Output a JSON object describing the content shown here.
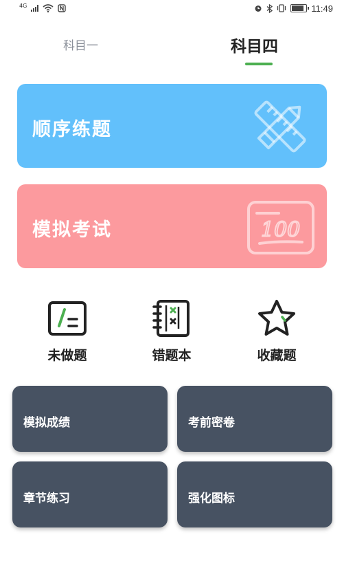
{
  "status_bar": {
    "network": "4G",
    "time": "11:49",
    "battery_level": 0.85,
    "icons": [
      "signal-icon",
      "wifi-icon",
      "nfc-icon",
      "alarm-icon",
      "bluetooth-icon",
      "vibrate-icon",
      "battery-icon"
    ]
  },
  "tabs": [
    {
      "label": "科目一",
      "selected": false
    },
    {
      "label": "科目四",
      "selected": true
    }
  ],
  "accent_color": "#4caf50",
  "cards": [
    {
      "label": "顺序练题",
      "icon": "pencil-ruler-icon",
      "color": "#62c0fb"
    },
    {
      "label": "模拟考试",
      "icon": "exam-score-icon",
      "color": "#fc9a9e"
    }
  ],
  "card_score_text": "100",
  "features": [
    {
      "label": "未做题",
      "icon": "undone-questions-icon"
    },
    {
      "label": "错题本",
      "icon": "wrong-notebook-icon"
    },
    {
      "label": "收藏题",
      "icon": "favorite-star-icon"
    }
  ],
  "tiles": [
    {
      "label": "模拟成绩"
    },
    {
      "label": "考前密卷"
    },
    {
      "label": "章节练习"
    },
    {
      "label": "强化图标"
    }
  ],
  "tile_color": "#475262"
}
